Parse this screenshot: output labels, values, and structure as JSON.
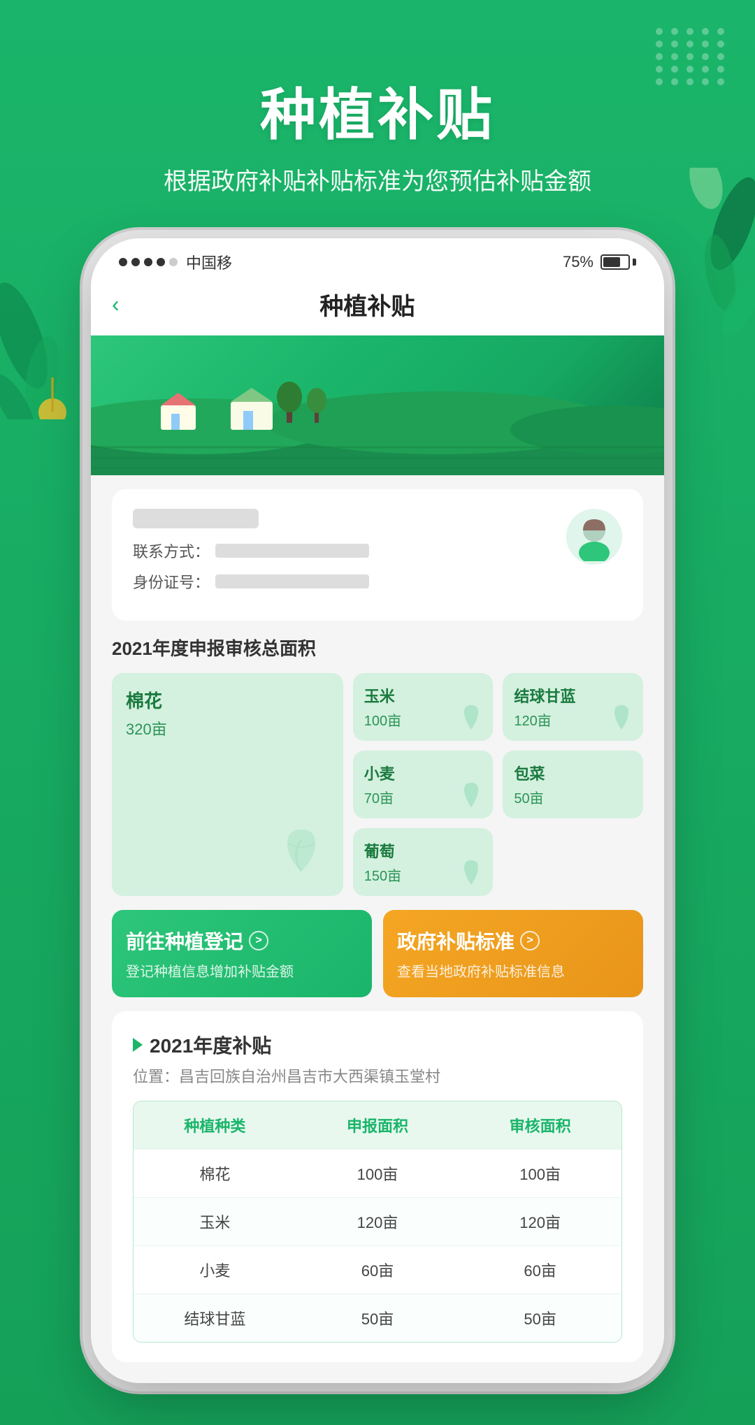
{
  "header": {
    "title": "种植补贴",
    "subtitle": "根据政府补贴补贴标准为您预估补贴金额"
  },
  "statusBar": {
    "carrier": "中国移",
    "battery": "75%",
    "signals": [
      "filled",
      "filled",
      "filled",
      "filled",
      "empty"
    ]
  },
  "navbar": {
    "backLabel": "‹",
    "title": "种植补贴"
  },
  "userCard": {
    "contactLabel": "联系方式：",
    "idLabel": "身份证号："
  },
  "cropSection": {
    "title": "2021年度申报审核总面积",
    "crops": [
      {
        "name": "棉花",
        "area": "320亩",
        "big": true
      },
      {
        "name": "玉米",
        "area": "100亩",
        "big": false
      },
      {
        "name": "结球甘蓝",
        "area": "120亩",
        "big": false
      },
      {
        "name": "小麦",
        "area": "70亩",
        "big": false
      },
      {
        "name": "包菜",
        "area": "50亩",
        "big": false
      },
      {
        "name": "葡萄",
        "area": "150亩",
        "big": false
      }
    ]
  },
  "actions": {
    "register": {
      "title": "前往种植登记",
      "desc": "登记种植信息增加补贴金额",
      "arrow": ">"
    },
    "standard": {
      "title": "政府补贴标准",
      "desc": "查看当地政府补贴标准信息",
      "arrow": ">"
    }
  },
  "subsidy": {
    "title": "2021年度补贴",
    "location": "位置：昌吉回族自治州昌吉市大西渠镇玉堂村",
    "tableHeaders": [
      "种植种类",
      "申报面积",
      "审核面积"
    ],
    "tableRows": [
      [
        "棉花",
        "100亩",
        "100亩"
      ],
      [
        "玉米",
        "120亩",
        "120亩"
      ],
      [
        "小麦",
        "60亩",
        "60亩"
      ],
      [
        "结球甘蓝",
        "50亩",
        "50亩"
      ]
    ]
  },
  "colors": {
    "green": "#1ab56a",
    "lightGreen": "#d4f0df",
    "orange": "#f5a623",
    "white": "#ffffff"
  }
}
